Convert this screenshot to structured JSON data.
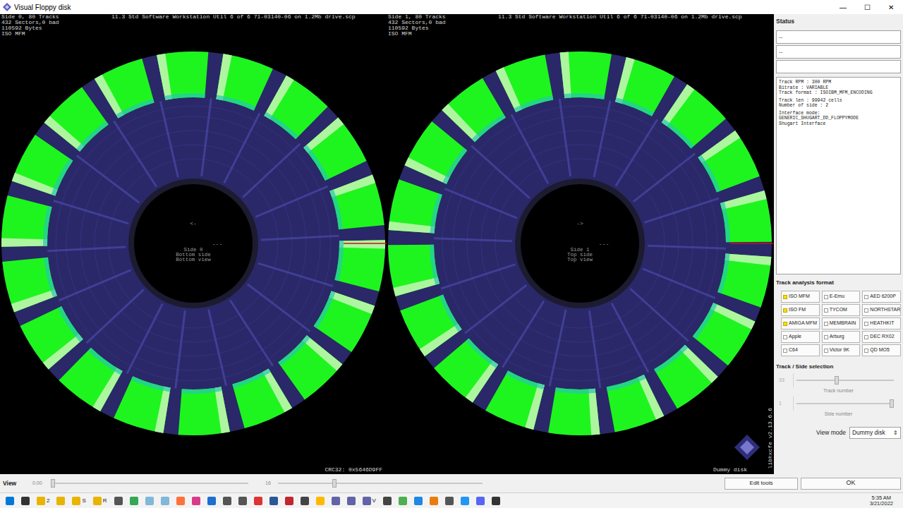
{
  "window": {
    "title": "Visual Floppy disk",
    "controls": [
      "—",
      "☐",
      "✕"
    ]
  },
  "disks": [
    {
      "stats": [
        "Side 0, 80 Tracks",
        "432 Sectors,0 bad",
        "110592 Bytes",
        "ISO MFM"
      ],
      "title": "11.3 Std Software Workstation Util 6 of 6 71-03140-06 on 1.2Mb drive.scp",
      "arrow": "<-",
      "marker": "---",
      "center_lines": [
        "Side 0",
        "Bottom side",
        "Bottom view"
      ],
      "sectors": [
        {
          "good": true
        },
        {
          "good": true
        },
        {
          "good": true
        },
        {
          "good": true
        },
        {
          "good": true
        },
        {
          "good": true
        },
        {
          "good": true
        },
        {
          "good": true
        },
        {
          "good": true
        },
        {
          "good": true
        },
        {
          "good": true
        },
        {
          "good": true
        },
        {
          "good": true
        },
        {
          "good": true
        },
        {
          "good": true
        },
        {
          "good": true
        },
        {
          "good": true
        },
        {
          "good": true
        }
      ]
    },
    {
      "stats": [
        "Side 1, 80 Tracks",
        "432 Sectors,0 bad",
        "110592 Bytes",
        "ISO MFM"
      ],
      "title": "11.3 Std Software Workstation Util 6 of 6 71-03140-06 on 1.2Mb drive.scp",
      "arrow": "->",
      "marker": "---",
      "center_lines": [
        "Side 1",
        "Top side",
        "Top view"
      ],
      "sectors": [
        {
          "good": true
        },
        {
          "good": true
        },
        {
          "good": true
        },
        {
          "good": true
        },
        {
          "good": true
        },
        {
          "good": true
        },
        {
          "good": true
        },
        {
          "good": true
        },
        {
          "good": true
        },
        {
          "good": true
        },
        {
          "good": true
        },
        {
          "good": true
        },
        {
          "good": true
        },
        {
          "good": true
        },
        {
          "good": true
        },
        {
          "good": true
        },
        {
          "good": true
        },
        {
          "good": true
        }
      ]
    }
  ],
  "footer": {
    "crc": "CRC32: 0x5646D9FF",
    "mode": "Dummy disk",
    "version": "libhxcfe v2.13.6.6"
  },
  "status": {
    "label": "Status",
    "fields": [
      "--",
      "--",
      ""
    ],
    "info": [
      "Track RPM : 300 RPM",
      "Bitrate : VARIABLE",
      "Track format : ISOIBM_MFM_ENCODING",
      "Track len : 99942 cells",
      "Number of side : 2",
      "Interface mode:",
      "GENERIC_SHUGART_DD_FLOPPYMODE",
      "Shugart Interface"
    ]
  },
  "track_analysis": {
    "label": "Track analysis format",
    "formats": [
      {
        "label": "ISO MFM",
        "checked": true
      },
      {
        "label": "E-Emu",
        "checked": false
      },
      {
        "label": "AED 6200P",
        "checked": false
      },
      {
        "label": "ISO FM",
        "checked": true
      },
      {
        "label": "TYCOM",
        "checked": false
      },
      {
        "label": "NORTHSTAR",
        "checked": false
      },
      {
        "label": "AMIGA MFM",
        "checked": true
      },
      {
        "label": "MEMBRAIN",
        "checked": false
      },
      {
        "label": "HEATHKIT",
        "checked": false
      },
      {
        "label": "Apple",
        "checked": false
      },
      {
        "label": "Arburg",
        "checked": false
      },
      {
        "label": "DEC RX02",
        "checked": false
      },
      {
        "label": "C64",
        "checked": false
      },
      {
        "label": "Victor 9K",
        "checked": false
      },
      {
        "label": "QD MO5",
        "checked": false
      }
    ]
  },
  "track_side": {
    "label": "Track / Side selection",
    "sliders": [
      {
        "value": "33",
        "label": "Track number",
        "disabled": true,
        "level": 0.41
      },
      {
        "value": "1",
        "label": "Side number",
        "disabled": true,
        "level": 1
      }
    ]
  },
  "view_mode": {
    "label": "View mode",
    "value": "Dummy disk",
    "arrow": "⇕"
  },
  "bottom_bar": {
    "label": "View",
    "sliders": [
      {
        "value": "0.00",
        "level": 0
      },
      {
        "value": "16",
        "level": 0.27
      }
    ],
    "edit_tools": "Edit tools",
    "ok": "OK"
  },
  "taskbar": {
    "apps": [
      {
        "label": "",
        "color": "#0078d7"
      },
      {
        "label": "",
        "color": "#333333"
      },
      {
        "label": "2",
        "color": "#e8b400"
      },
      {
        "label": "",
        "color": "#e8b400"
      },
      {
        "label": "S",
        "color": "#e8b400"
      },
      {
        "label": "R",
        "color": "#e8b400"
      },
      {
        "label": "",
        "color": "#555555"
      },
      {
        "label": "",
        "color": "#34a853"
      },
      {
        "label": "",
        "color": "#7fb8d8"
      },
      {
        "label": "",
        "color": "#7fb8d8"
      },
      {
        "label": "",
        "color": "#ff7139"
      },
      {
        "label": "",
        "color": "#d83b8a"
      },
      {
        "label": "",
        "color": "#1e6fd0"
      },
      {
        "label": "",
        "color": "#555555"
      },
      {
        "label": "",
        "color": "#555555"
      },
      {
        "label": "",
        "color": "#dd3333"
      },
      {
        "label": "",
        "color": "#2b5797"
      },
      {
        "label": "",
        "color": "#c1272d"
      },
      {
        "label": "",
        "color": "#444444"
      },
      {
        "label": "",
        "color": "#ffb900"
      },
      {
        "label": "",
        "color": "#6264a7"
      },
      {
        "label": "",
        "color": "#6264a7"
      },
      {
        "label": "V",
        "color": "#6264a7"
      },
      {
        "label": "",
        "color": "#444444"
      },
      {
        "label": "",
        "color": "#4caf50"
      },
      {
        "label": "",
        "color": "#1e88e5"
      },
      {
        "label": "",
        "color": "#e87d0d"
      },
      {
        "label": "",
        "color": "#555555"
      },
      {
        "label": "",
        "color": "#2196f3"
      },
      {
        "label": "",
        "color": "#5865f2"
      },
      {
        "label": "",
        "color": "#333333"
      }
    ],
    "time": "5:35 AM",
    "date": "3/21/2022"
  }
}
